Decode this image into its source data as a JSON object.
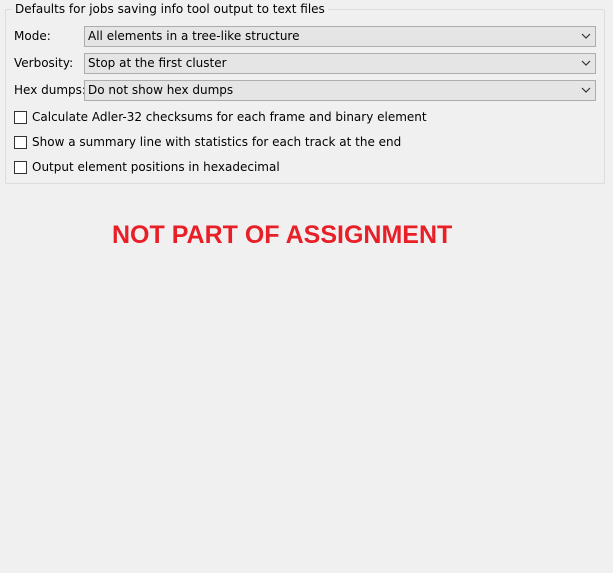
{
  "group": {
    "title": "Defaults for jobs saving info tool output to text files"
  },
  "fields": [
    {
      "label": "Mode:",
      "value": "All elements in a tree-like structure"
    },
    {
      "label": "Verbosity:",
      "value": "Stop at the first cluster"
    },
    {
      "label": "Hex dumps:",
      "value": "Do not show hex dumps"
    }
  ],
  "checkboxes": [
    {
      "label": "Calculate Adler-32 checksums for each frame and binary element",
      "checked": false
    },
    {
      "label": "Show a summary line with statistics for each track at the end",
      "checked": false
    },
    {
      "label": "Output element positions in hexadecimal",
      "checked": false
    }
  ],
  "overlay_text": "NOT PART OF ASSIGNMENT",
  "colors": {
    "background": "#f0f0f0",
    "combo_background": "#e5e5e5",
    "overlay_text": "#e81f27"
  },
  "icons": {
    "combo_arrow": "chevron-down-icon"
  }
}
